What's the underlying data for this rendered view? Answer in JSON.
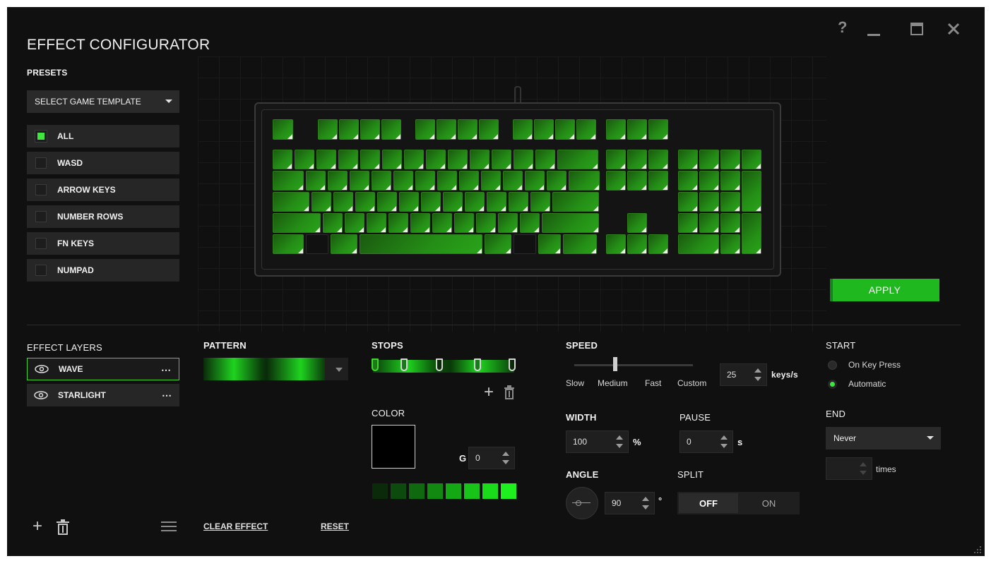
{
  "window": {
    "title": "EFFECT CONFIGURATOR",
    "controls": {
      "help": "?",
      "minimize": "–",
      "maximize": "□",
      "close": "✕"
    }
  },
  "presets": {
    "label": "PRESETS",
    "dropdown": "SELECT GAME TEMPLATE",
    "items": [
      {
        "label": "ALL",
        "checked": true
      },
      {
        "label": "WASD",
        "checked": false
      },
      {
        "label": "ARROW KEYS",
        "checked": false
      },
      {
        "label": "NUMBER ROWS",
        "checked": false
      },
      {
        "label": "FN KEYS",
        "checked": false
      },
      {
        "label": "NUMPAD",
        "checked": false
      }
    ]
  },
  "apply_label": "APPLY",
  "layers": {
    "label": "EFFECT LAYERS",
    "items": [
      {
        "name": "WAVE",
        "selected": true
      },
      {
        "name": "STARLIGHT",
        "selected": false
      }
    ],
    "more": "⋯"
  },
  "pattern": {
    "label": "PATTERN"
  },
  "stops": {
    "label": "STOPS"
  },
  "color": {
    "label": "COLOR",
    "channel": "G",
    "value": "0",
    "current": "#000000",
    "palette": [
      "#0a2a0a",
      "#0d4a0d",
      "#0f6a0f",
      "#128a12",
      "#15a815",
      "#18c418",
      "#1bdc1b",
      "#1ef01e"
    ]
  },
  "speed": {
    "label": "SPEED",
    "ticks": [
      "Slow",
      "Medium",
      "Fast",
      "Custom"
    ],
    "value": "25",
    "unit": "keys/s"
  },
  "width": {
    "label": "WIDTH",
    "value": "100",
    "unit": "%"
  },
  "pause": {
    "label": "PAUSE",
    "value": "0",
    "unit": "s"
  },
  "angle": {
    "label": "ANGLE",
    "value": "90",
    "unit": "°"
  },
  "split": {
    "label": "SPLIT",
    "off": "OFF",
    "on": "ON",
    "active": "OFF"
  },
  "start": {
    "label": "START",
    "options": [
      {
        "label": "On Key Press",
        "selected": false
      },
      {
        "label": "Automatic",
        "selected": true
      }
    ]
  },
  "end": {
    "label": "END",
    "value": "Never",
    "times_label": "times",
    "times_value": ""
  },
  "footer": {
    "add": "+",
    "clear": "CLEAR EFFECT",
    "reset": "RESET"
  },
  "accent": "#44d62c"
}
